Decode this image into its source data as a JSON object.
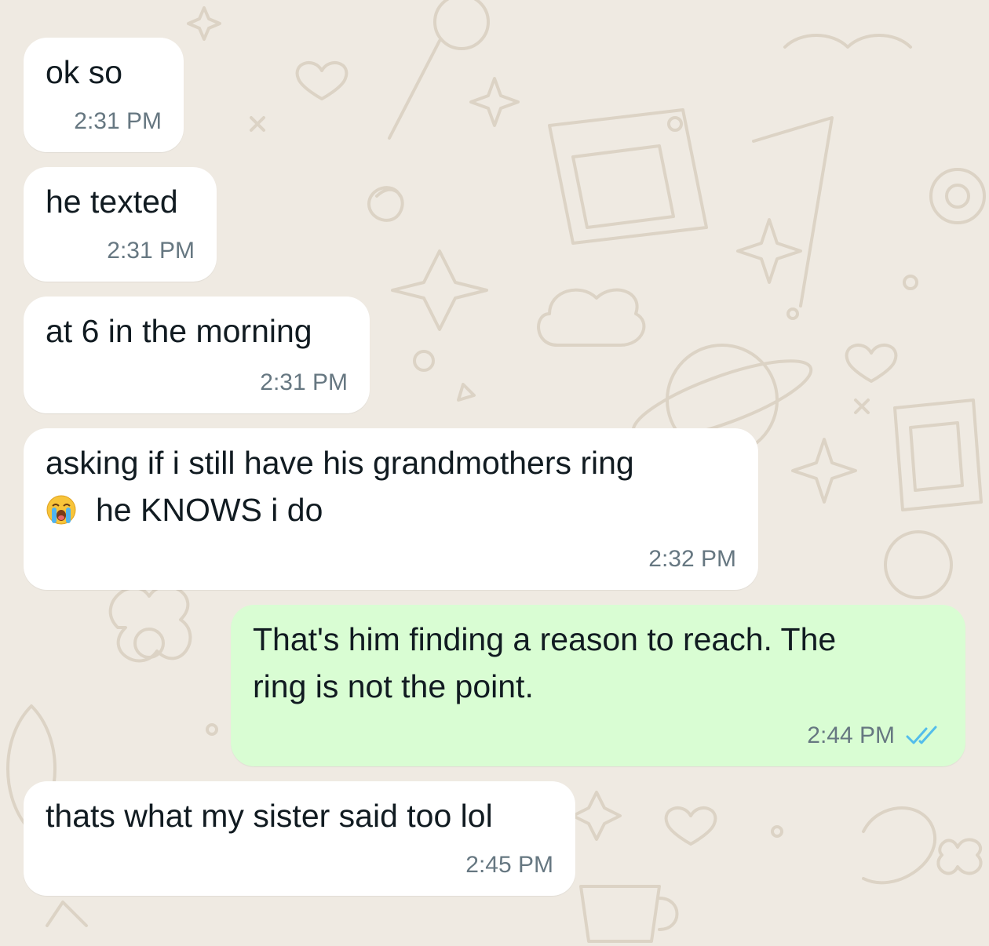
{
  "chat": {
    "messages": [
      {
        "id": "m1",
        "direction": "incoming",
        "lines": [
          "ok so"
        ],
        "time": "2:31 PM"
      },
      {
        "id": "m2",
        "direction": "incoming",
        "lines": [
          "he texted"
        ],
        "time": "2:31 PM"
      },
      {
        "id": "m3",
        "direction": "incoming",
        "lines": [
          "at 6 in the morning"
        ],
        "time": "2:31 PM"
      },
      {
        "id": "m4",
        "direction": "incoming",
        "lines": [
          "asking if i still have his grandmothers ring",
          "he KNOWS i do"
        ],
        "emoji": "loudly-crying-face-emoji",
        "time": "2:32 PM"
      },
      {
        "id": "m5",
        "direction": "outgoing",
        "lines": [
          "That's him finding a reason to reach. The",
          "ring is not the point."
        ],
        "time": "2:44 PM",
        "status": "read",
        "status_icon": "double-check-icon"
      },
      {
        "id": "m6",
        "direction": "incoming",
        "lines": [
          "thats what my sister said too lol"
        ],
        "time": "2:45 PM"
      }
    ]
  },
  "colors": {
    "background": "#efeae2",
    "doodle": "#dcd3c5",
    "incoming_bubble": "#ffffff",
    "outgoing_bubble": "#d9fdd3",
    "text": "#111b21",
    "time": "#667781",
    "read_ticks": "#53bdeb"
  }
}
